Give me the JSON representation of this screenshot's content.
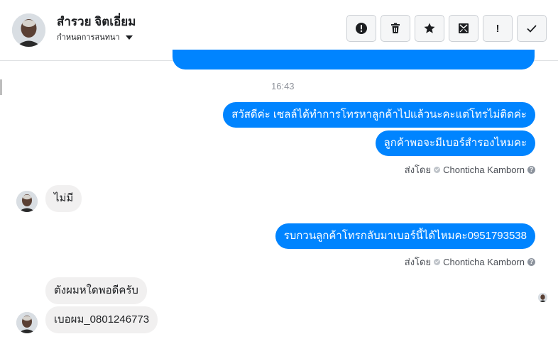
{
  "header": {
    "contact_name": "สำรวย จิตเอี่ยม",
    "assign_label": "กำหนดการสนทนา",
    "actions": [
      {
        "icon": "alert-circle-icon",
        "label": ""
      },
      {
        "icon": "trash-icon",
        "label": ""
      },
      {
        "icon": "star-icon",
        "label": ""
      },
      {
        "icon": "mark-unread-icon",
        "label": ""
      },
      {
        "icon": "follow-up-icon",
        "label": "!"
      },
      {
        "icon": "checkmark-icon",
        "label": ""
      }
    ]
  },
  "conversation": {
    "timestamp": "16:43",
    "messages": [
      {
        "direction": "out",
        "text": "สวัสดีค่ะ เซลล์ได้ทำการโทรหาลูกค้าไปแล้วนะคะแต่โทรไม่ติดค่ะ"
      },
      {
        "direction": "out",
        "text": "ลูกค้าพอจะมีเบอร์สำรองไหมคะ"
      },
      {
        "direction": "in",
        "text": "ไม่มี"
      },
      {
        "direction": "out",
        "text": "รบกวนลูกค้าโทรกลับมาเบอร์นี้ได้ไหมคะ0951793538"
      },
      {
        "direction": "in",
        "text": "ตังผมหใดพอดีครับ"
      },
      {
        "direction": "in",
        "text": "เบอผม_0801246773"
      }
    ],
    "sent_by": [
      {
        "prefix": "ส่งโดย",
        "agent": "Chonticha Kamborn"
      },
      {
        "prefix": "ส่งโดย",
        "agent": "Chonticha Kamborn"
      }
    ]
  },
  "colors": {
    "outgoing_bubble": "#0084ff",
    "incoming_bubble": "#f1f0f0",
    "divider": "#dddfe2"
  }
}
